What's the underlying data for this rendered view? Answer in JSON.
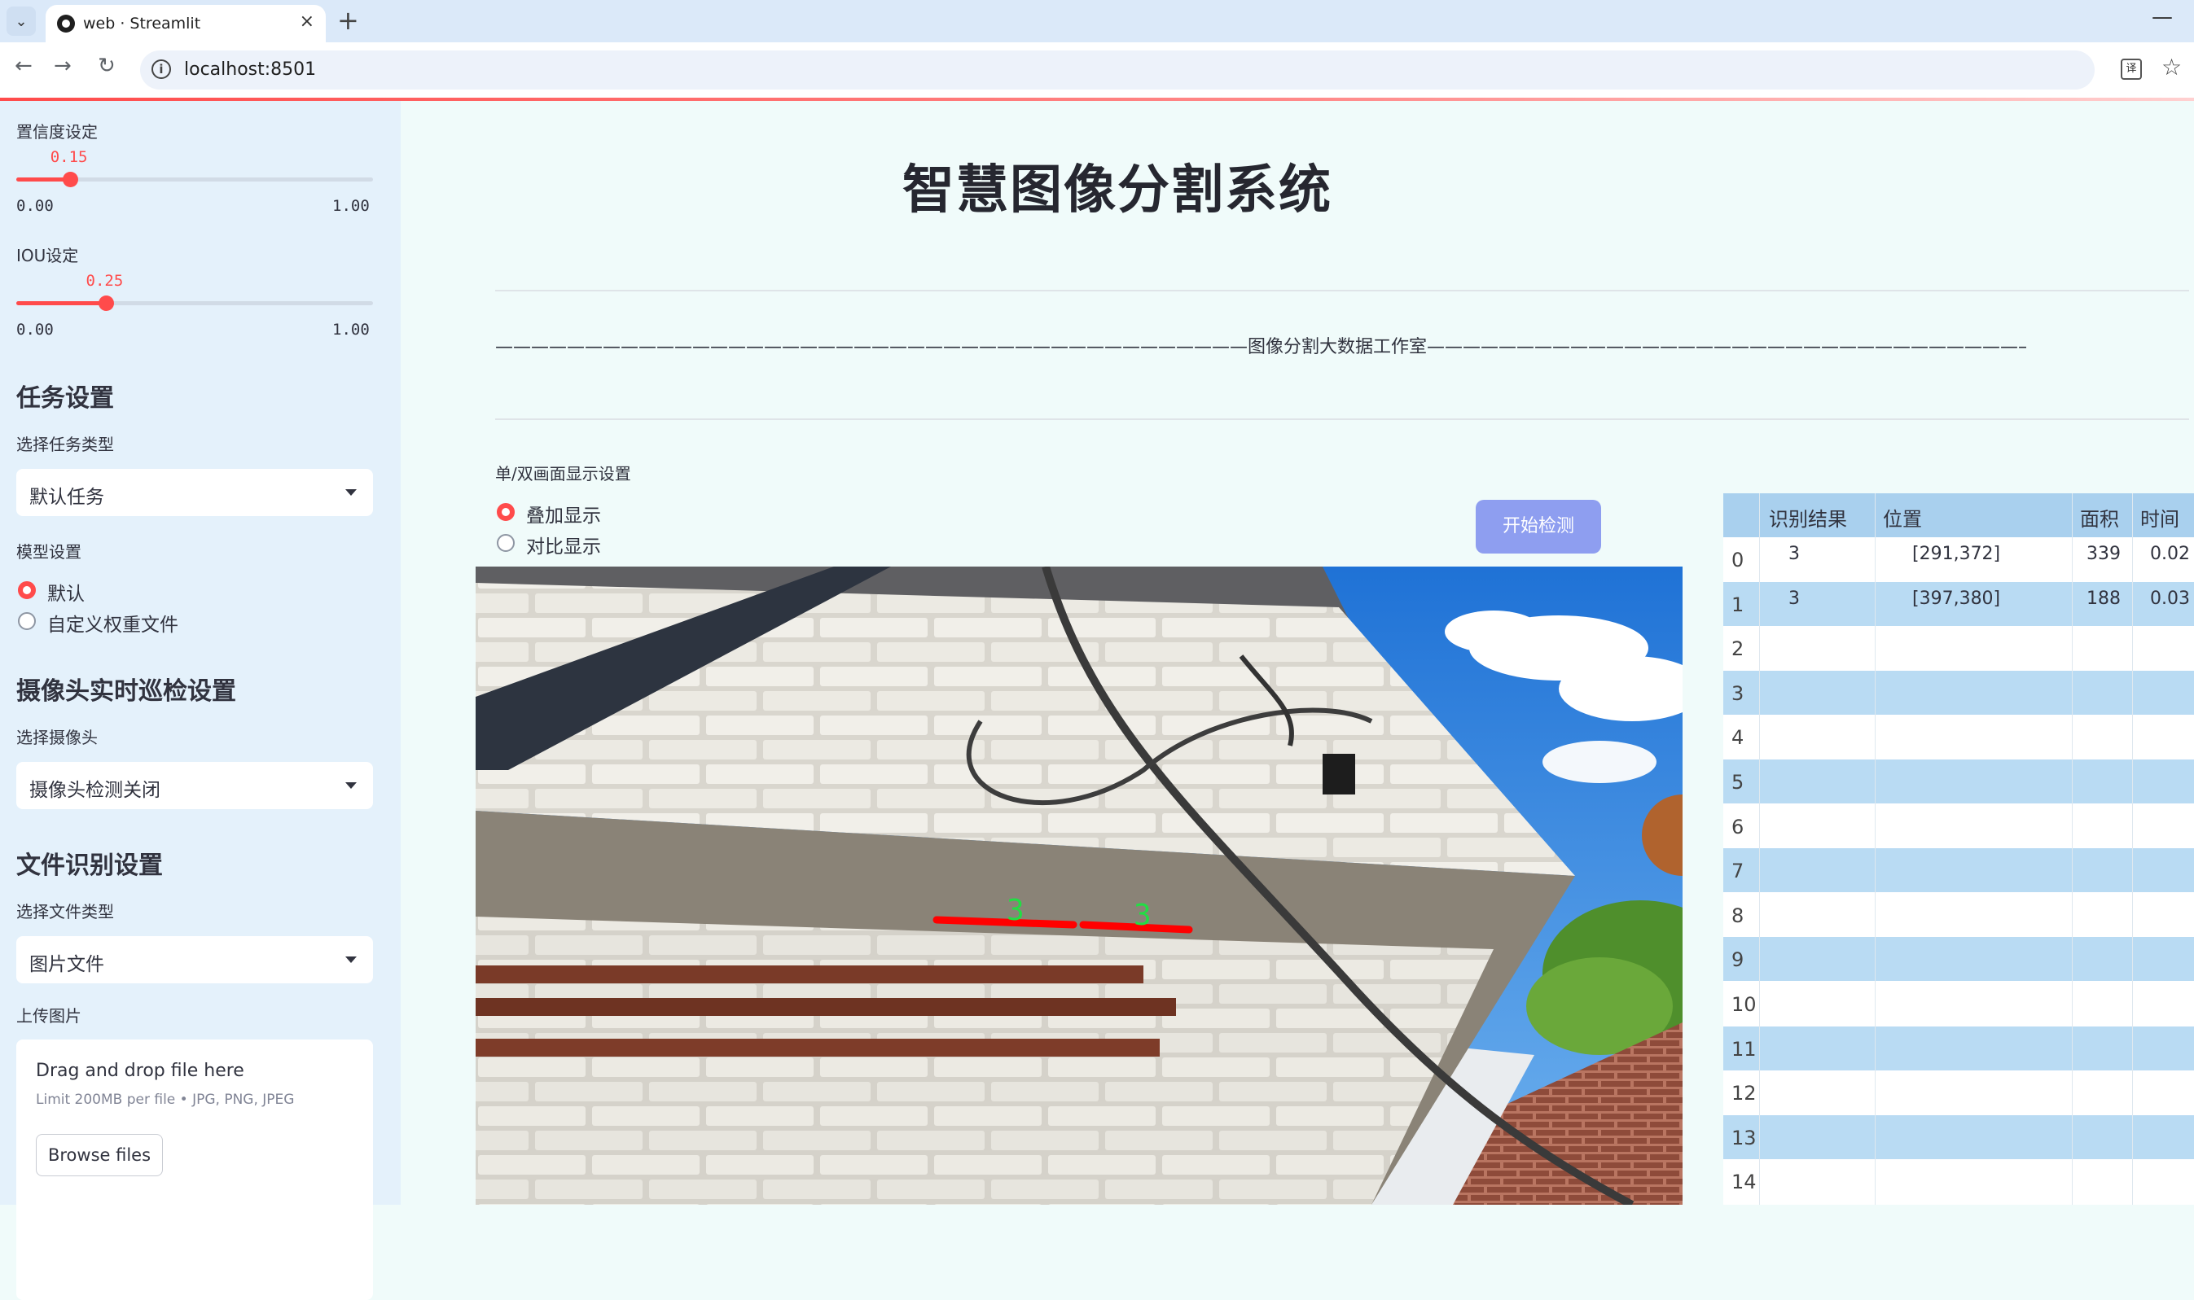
{
  "browser": {
    "tab_title": "web · Streamlit",
    "tab_close": "×",
    "new_tab": "+",
    "minimize": "—",
    "url": "localhost:8501",
    "back": "←",
    "forward": "→",
    "reload": "↻",
    "star": "☆",
    "translate": "译"
  },
  "sidebar": {
    "confidence": {
      "label": "置信度设定",
      "value": "0.15",
      "min": "0.00",
      "max": "1.00",
      "fraction": 0.15
    },
    "iou": {
      "label": "IOU设定",
      "value": "0.25",
      "min": "0.00",
      "max": "1.00",
      "fraction": 0.25
    },
    "task": {
      "heading": "任务设置",
      "select_label": "选择任务类型",
      "selected": "默认任务"
    },
    "model": {
      "label": "模型设置",
      "options": [
        "默认",
        "自定义权重文件"
      ],
      "selected_index": 0
    },
    "camera": {
      "heading": "摄像头实时巡检设置",
      "select_label": "选择摄像头",
      "selected": "摄像头检测关闭"
    },
    "file": {
      "heading": "文件识别设置",
      "select_label": "选择文件类型",
      "selected": "图片文件",
      "upload_label": "上传图片"
    },
    "uploader": {
      "title": "Drag and drop file here",
      "subtitle": "Limit 200MB per file • JPG, PNG, JPEG",
      "button": "Browse files"
    }
  },
  "main": {
    "title": "智慧图像分割系统",
    "divider_text": "——————————————————————————————————————————图像分割大数据工作室——————————————————————————————————————————",
    "display_label": "单/双画面显示设置",
    "display_options": [
      "叠加显示",
      "对比显示"
    ],
    "display_selected": 0,
    "start_button": "开始检测",
    "detections": [
      {
        "label": "3"
      },
      {
        "label": "3"
      }
    ]
  },
  "table": {
    "columns": [
      "识别结果",
      "位置",
      "面积",
      "时间"
    ],
    "rows": [
      {
        "index": "0",
        "result": "3",
        "position": "[291,372]",
        "area": "339",
        "time": "0.02"
      },
      {
        "index": "1",
        "result": "3",
        "position": "[397,380]",
        "area": "188",
        "time": "0.03"
      },
      {
        "index": "2"
      },
      {
        "index": "3"
      },
      {
        "index": "4"
      },
      {
        "index": "5"
      },
      {
        "index": "6"
      },
      {
        "index": "7"
      },
      {
        "index": "8"
      },
      {
        "index": "9"
      },
      {
        "index": "10"
      },
      {
        "index": "11"
      },
      {
        "index": "12"
      },
      {
        "index": "13"
      },
      {
        "index": "14"
      }
    ]
  },
  "colors": {
    "accent": "#ff4b4b",
    "button": "#8e9ef0",
    "sidebar_bg": "#e4f1fb",
    "mask": "#ff0000",
    "label": "#22dd44"
  }
}
